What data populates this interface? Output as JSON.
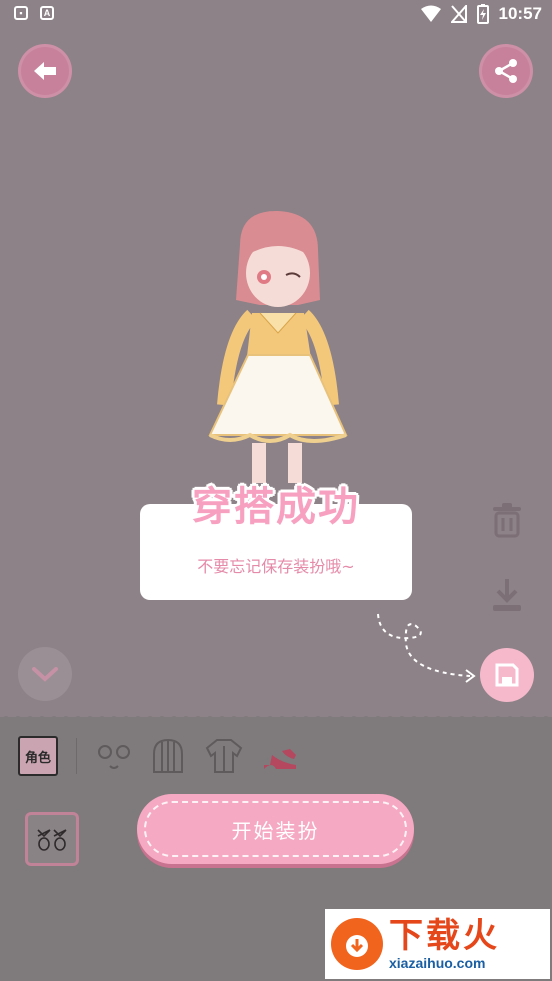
{
  "status_bar": {
    "time": "10:57"
  },
  "toast": {
    "title": "穿搭成功",
    "subtitle": "不要忘记保存装扮哦~"
  },
  "tabs": {
    "role_label": "角色"
  },
  "actions": {
    "start_label": "开始装扮"
  },
  "watermark": {
    "title": "下载火",
    "url": "xiazaihuo.com"
  },
  "colors": {
    "overlay": "#8d8287",
    "accent_pink": "#f6a9c3",
    "button_pink": "#c8819b",
    "title_pink": "#f7a0c0",
    "subtitle_pink": "#e58aa9"
  }
}
